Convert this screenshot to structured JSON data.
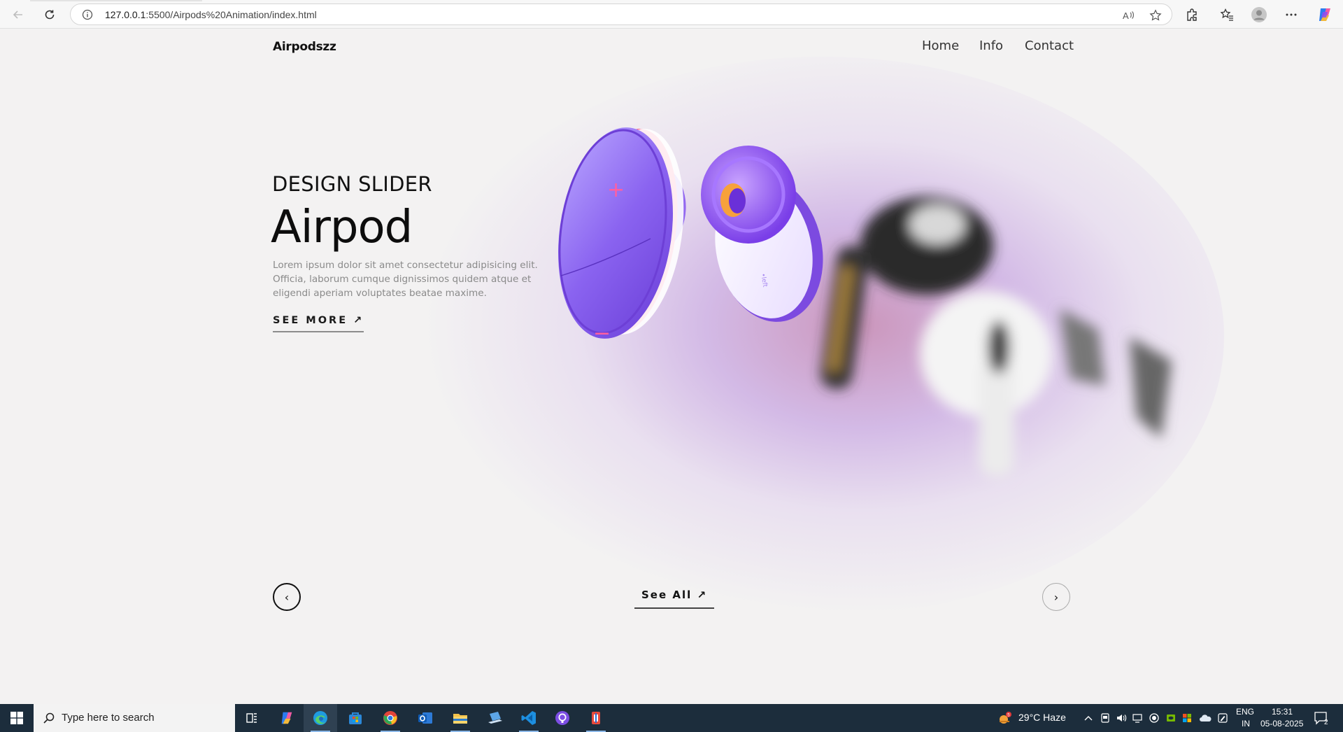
{
  "browser": {
    "url_host": "127.0.0.1",
    "url_rest": ":5500/Airpods%20Animation/index.html"
  },
  "site": {
    "logo": "Airpodszz",
    "nav": [
      "Home",
      "Info",
      "Contact"
    ]
  },
  "hero": {
    "eyebrow": "DESIGN SLIDER",
    "title": "Airpod",
    "description": "Lorem ipsum dolor sit amet consectetur adipisicing elit. Officia, laborum cumque dignissimos quidem atque et eligendi aperiam voluptates beatae maxime.",
    "see_more": "SEE MORE ↗"
  },
  "slider": {
    "prev": "‹",
    "next": "›",
    "see_all": "See All ↗"
  },
  "taskbar": {
    "search_placeholder": "Type here to search",
    "weather": "29°C  Haze",
    "weather_badge": "5",
    "lang_top": "ENG",
    "lang_bottom": "IN",
    "time": "15:31",
    "date": "05-08-2025",
    "notifications": "2"
  },
  "colors": {
    "accent_purple": "#8a5cf0",
    "taskbar_bg": "#1c2d3c",
    "page_bg": "#f3f2f2"
  }
}
